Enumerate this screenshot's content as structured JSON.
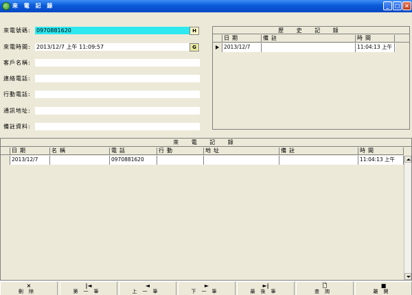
{
  "window": {
    "title": "來 電 記 錄",
    "min_glyph": "_",
    "max_glyph": "□",
    "close_glyph": "×"
  },
  "form": {
    "phone_label": "來電號碼:",
    "phone_value": "0970881620",
    "phone_btn": "H",
    "time_label": "來電時間:",
    "time_value": "2013/12/7 上午 11:09:57",
    "time_btn": "G",
    "customer_label": "客戶名稱:",
    "customer_value": "",
    "contact_label": "連絡電話:",
    "contact_value": "",
    "mobile_label": "行動電話:",
    "mobile_value": "",
    "address_label": "通訊地址:",
    "address_value": "",
    "notes_label": "備註資料:",
    "notes_value": ""
  },
  "history": {
    "title": "歷 史 記 錄",
    "columns": [
      "日期",
      "備註",
      "時間"
    ],
    "rows": [
      {
        "date": "2013/12/7",
        "note": "",
        "time": "11:04:13 上午"
      }
    ]
  },
  "calls": {
    "title": "來 電 記 錄",
    "columns": [
      "日期",
      "名稱",
      "電話",
      "行動",
      "地址",
      "備註",
      "時間"
    ],
    "rows": [
      {
        "date": "2013/12/7",
        "name": "",
        "phone": "0970881620",
        "mobile": "",
        "address": "",
        "note": "",
        "time": "11:04:13 上午"
      }
    ]
  },
  "toolbar": {
    "delete": {
      "label": "刪除",
      "icon": "×"
    },
    "first": {
      "label": "第一筆",
      "icon": "|◄"
    },
    "prev": {
      "label": "上一筆",
      "icon": "◄"
    },
    "next": {
      "label": "下一筆",
      "icon": "►"
    },
    "last": {
      "label": "最後筆",
      "icon": "►|"
    },
    "query": {
      "label": "查詢",
      "icon": "🗋"
    },
    "exit": {
      "label": "離開",
      "icon": "■"
    }
  }
}
